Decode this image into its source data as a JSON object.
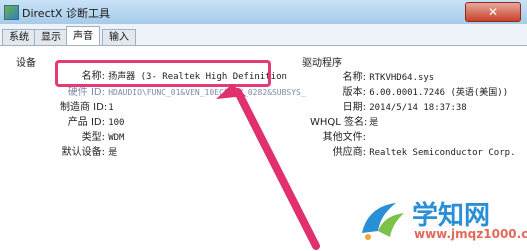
{
  "window": {
    "title": "DirectX 诊断工具"
  },
  "tabs": [
    {
      "label": "系统"
    },
    {
      "label": "显示"
    },
    {
      "label": "声音"
    },
    {
      "label": "输入"
    }
  ],
  "device_group": {
    "title": "设备",
    "rows": [
      {
        "label": "名称:",
        "value": "扬声器 (3- Realtek High Definition"
      },
      {
        "label": "硬件 ID:",
        "value": "HDAUDIO\\FUNC_01&VEN_10EC&DEV_0282&SUBSYS_"
      },
      {
        "label": "制造商 ID:",
        "value": "1"
      },
      {
        "label": "产品 ID:",
        "value": "100"
      },
      {
        "label": "类型:",
        "value": "WDM"
      },
      {
        "label": "默认设备:",
        "value": "是"
      }
    ]
  },
  "driver_group": {
    "title": "驱动程序",
    "rows": [
      {
        "label": "名称:",
        "value": "RTKVHD64.sys"
      },
      {
        "label": "版本:",
        "value": "6.00.0001.7246 (英语(美国))"
      },
      {
        "label": "日期:",
        "value": "2014/5/14 18:37:38"
      },
      {
        "label": "WHQL 签名:",
        "value": "是"
      },
      {
        "label": "其他文件:",
        "value": ""
      },
      {
        "label": "供应商:",
        "value": "Realtek Semiconductor Corp."
      }
    ]
  },
  "watermark": {
    "brand": "学知网",
    "url": "www.jmqz1000.com"
  },
  "colors": {
    "highlight": "#e53a79",
    "arrow": "#e0306f",
    "brand": "#2a8fd6"
  }
}
